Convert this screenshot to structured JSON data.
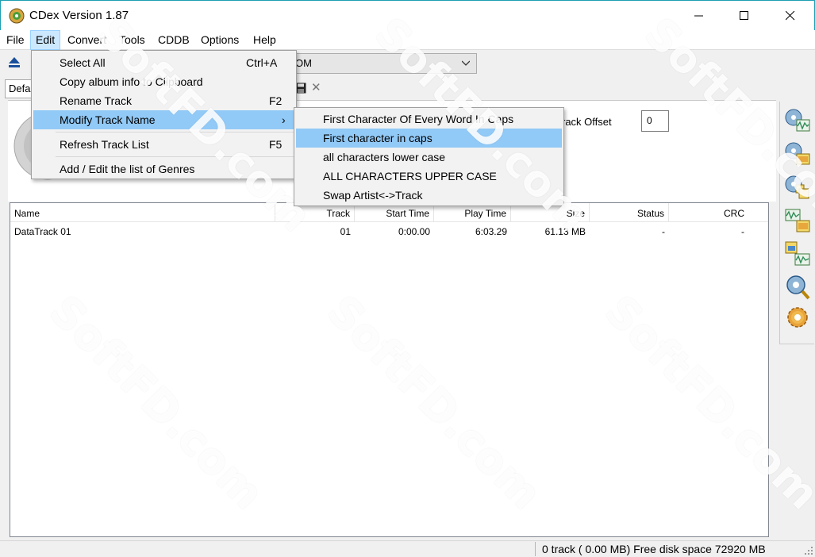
{
  "window": {
    "title": "CDex Version 1.87",
    "controls": [
      "minimize",
      "maximize",
      "close"
    ]
  },
  "menubar": {
    "items": [
      "File",
      "Edit",
      "Convert",
      "Tools",
      "CDDB",
      "Options",
      "Help"
    ],
    "active": "Edit"
  },
  "toolbar": {
    "drive_combo_value": "OM",
    "profile_tab": "Defa"
  },
  "edit_menu": {
    "items": [
      {
        "label": "Select All",
        "shortcut": "Ctrl+A"
      },
      {
        "label": "Copy album info to Clipboard",
        "shortcut": ""
      },
      {
        "label": "Rename Track",
        "shortcut": "F2"
      },
      {
        "label": "Modify Track Name",
        "shortcut": "›",
        "highlighted": true
      },
      {
        "label": "Refresh Track List",
        "shortcut": "F5"
      },
      {
        "label": "Add / Edit the list of Genres",
        "shortcut": ""
      }
    ]
  },
  "modify_submenu": {
    "items": [
      {
        "label": "First Character Of Every Word In Caps"
      },
      {
        "label": "First character in caps",
        "highlighted": true
      },
      {
        "label": "all characters lower case"
      },
      {
        "label": "ALL CHARACTERS UPPER CASE"
      },
      {
        "label": "Swap Artist<->Track"
      }
    ]
  },
  "album_info": {
    "offset_label": "rack Offset",
    "offset_value": "0"
  },
  "track_list": {
    "columns": [
      "Name",
      "Track",
      "Start Time",
      "Play Time",
      "Size",
      "Status",
      "CRC"
    ],
    "rows": [
      {
        "name": "DataTrack 01",
        "track": "01",
        "start_time": "0:00.00",
        "play_time": "6:03.29",
        "size": "61.13 MB",
        "status": "-",
        "crc": "-"
      }
    ]
  },
  "statusbar": {
    "text": "0 track ( 0.00 MB) Free disk space 72920 MB"
  },
  "watermark": {
    "text": "SoftFD.com"
  },
  "sidebar": {
    "icons": [
      "cd-to-wave-icon",
      "cd-to-mp3-icon",
      "cd-to-file-icon",
      "wave-convert-icon",
      "file-convert-icon",
      "cd-search-icon",
      "settings-gear-icon"
    ]
  },
  "colors": {
    "titlebar_border": "#1d9fb3",
    "menu_highlight": "#91c9f7",
    "active_menu_bg": "#cce8ff"
  }
}
